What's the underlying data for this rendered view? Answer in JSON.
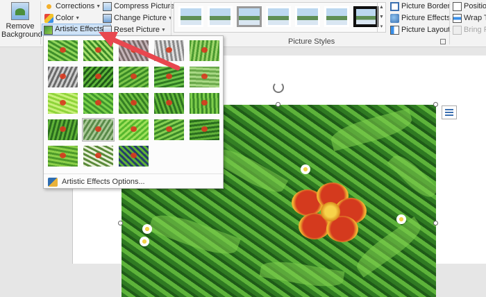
{
  "ribbon": {
    "remove_background": "Remove Background",
    "corrections": "Corrections",
    "color": "Color",
    "artistic_effects": "Artistic Effects",
    "compress_pictures": "Compress Pictures",
    "change_picture": "Change Picture",
    "reset_picture": "Reset Picture",
    "picture_styles_label": "Picture Styles",
    "picture_border": "Picture Border",
    "picture_effects": "Picture Effects",
    "picture_layout": "Picture Layout",
    "position": "Positio",
    "wrap_text": "Wrap Te",
    "bring_forward": "Bring Fo"
  },
  "artistic_effects_menu": {
    "options_label": "Artistic Effects Options...",
    "selected_index": 16,
    "effects": [
      {
        "base": "#3f8f2a",
        "accent": "#8fd45a",
        "name": "none"
      },
      {
        "base": "#3c8a28",
        "accent": "#a6df6a",
        "name": "marker"
      },
      {
        "base": "#7a6a6a",
        "accent": "#c4b4b8",
        "name": "pencil-grayscale"
      },
      {
        "base": "#8a8a8a",
        "accent": "#e0e0e0",
        "name": "pencil-sketch"
      },
      {
        "base": "#4c9a30",
        "accent": "#9ed66a",
        "name": "line-drawing"
      },
      {
        "base": "#6a6a6a",
        "accent": "#cfcfcf",
        "name": "chalk-sketch"
      },
      {
        "base": "#1f5a18",
        "accent": "#5db33a",
        "name": "paint-strokes"
      },
      {
        "base": "#3a8a26",
        "accent": "#7cc64a",
        "name": "paint-brush"
      },
      {
        "base": "#2f7a22",
        "accent": "#6cc24a",
        "name": "glow-diffused"
      },
      {
        "base": "#6aa84a",
        "accent": "#a8d884",
        "name": "blur"
      },
      {
        "base": "#8fd43a",
        "accent": "#c8f07a",
        "name": "light-screen"
      },
      {
        "base": "#3f962c",
        "accent": "#7ad04a",
        "name": "watercolor-sponge"
      },
      {
        "base": "#357f24",
        "accent": "#6fbf42",
        "name": "film-grain"
      },
      {
        "base": "#2d7420",
        "accent": "#64b83c",
        "name": "mosaic-bubbles"
      },
      {
        "base": "#3c8a28",
        "accent": "#7fce4c",
        "name": "glass"
      },
      {
        "base": "#2a6c1e",
        "accent": "#5fb238",
        "name": "cement"
      },
      {
        "base": "#5a8a4a",
        "accent": "#a7c894",
        "name": "texturizer"
      },
      {
        "base": "#57b82e",
        "accent": "#9fe05a",
        "name": "crisscross-etching"
      },
      {
        "base": "#3c8a28",
        "accent": "#86cf52",
        "name": "pastels-smooth"
      },
      {
        "base": "#2b6e1f",
        "accent": "#62b23a",
        "name": "plastic-wrap"
      },
      {
        "base": "#4e9a2a",
        "accent": "#8cd04a",
        "name": "cutout"
      },
      {
        "base": "#e8f0d8",
        "accent": "#5a8a3a",
        "name": "photocopy"
      },
      {
        "base": "#25406a",
        "accent": "#5fb238",
        "name": "glow-edges"
      }
    ]
  }
}
